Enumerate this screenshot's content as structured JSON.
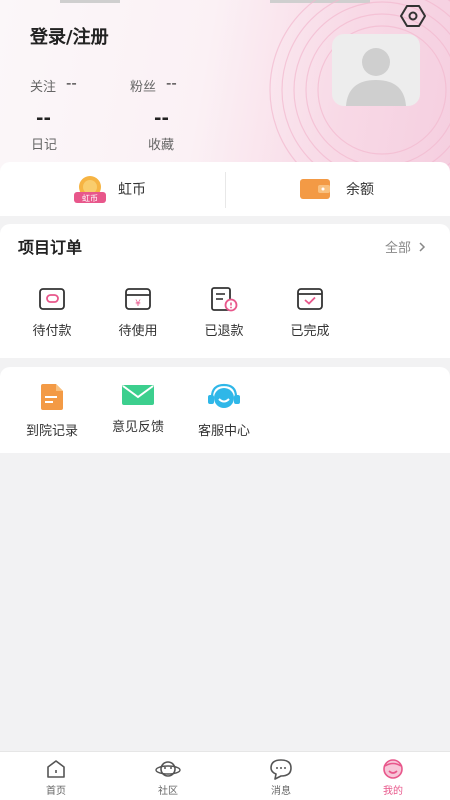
{
  "header": {
    "login_label": "登录/注册",
    "stats": {
      "following_label": "关注",
      "following_value": "--",
      "fans_label": "粉丝",
      "fans_value": "--",
      "diary_value": "--",
      "diary_label": "日记",
      "favorites_value": "--",
      "favorites_label": "收藏"
    },
    "settings_icon": "settings-eye-icon"
  },
  "wallet": {
    "coin_badge": "虹币",
    "coin_label": "虹币",
    "balance_label": "余额",
    "coin_color": "#f2a33a",
    "balance_color": "#f39a45"
  },
  "orders": {
    "title": "项目订单",
    "all_label": "全部",
    "items": [
      {
        "label": "待付款",
        "icon": "pending-payment-icon"
      },
      {
        "label": "待使用",
        "icon": "to-use-icon"
      },
      {
        "label": "已退款",
        "icon": "refunded-icon"
      },
      {
        "label": "已完成",
        "icon": "completed-icon"
      }
    ]
  },
  "services": {
    "items": [
      {
        "label": "到院记录",
        "icon": "visit-record-icon",
        "color": "#f39a45"
      },
      {
        "label": "意见反馈",
        "icon": "feedback-icon",
        "color": "#3ccf8e"
      },
      {
        "label": "客服中心",
        "icon": "customer-service-icon",
        "color": "#2fb7e8"
      }
    ]
  },
  "tabbar": {
    "items": [
      {
        "label": "首页",
        "icon": "home-icon"
      },
      {
        "label": "社区",
        "icon": "community-planet-icon"
      },
      {
        "label": "消息",
        "icon": "message-icon"
      },
      {
        "label": "我的",
        "icon": "mine-face-icon",
        "active": true
      }
    ],
    "active_color": "#e8578b"
  }
}
